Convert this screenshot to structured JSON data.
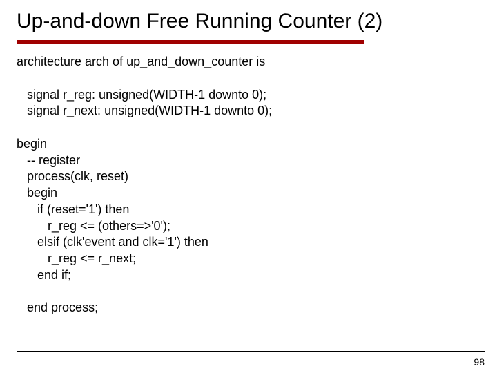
{
  "slide": {
    "title": "Up-and-down Free Running Counter (2)",
    "code": "architecture arch of up_and_down_counter is\n\n   signal r_reg: unsigned(WIDTH-1 downto 0);\n   signal r_next: unsigned(WIDTH-1 downto 0);\n\nbegin\n   -- register\n   process(clk, reset)\n   begin\n      if (reset='1') then\n         r_reg <= (others=>'0');\n      elsif (clk'event and clk='1') then\n         r_reg <= r_next;\n      end if;\n\n   end process;",
    "page": "98"
  }
}
